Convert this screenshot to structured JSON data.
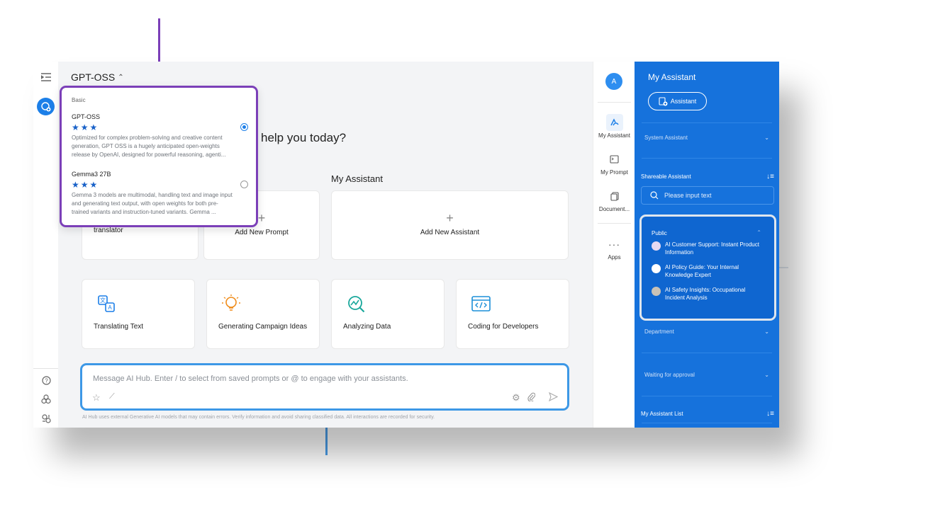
{
  "header": {
    "model_name": "GPT-OSS"
  },
  "main": {
    "greeting_partial": "help you today?",
    "my_assistant_label": "My Assistant",
    "prompt_cards": [
      {
        "label": "translator"
      },
      {
        "label": "Add New Prompt"
      },
      {
        "label": "Add New Assistant"
      }
    ],
    "features": [
      {
        "label": "Translating Text",
        "icon": "translate-icon"
      },
      {
        "label": "Generating Campaign Ideas",
        "icon": "lightbulb-icon"
      },
      {
        "label": "Analyzing Data",
        "icon": "analytics-icon"
      },
      {
        "label": "Coding for Developers",
        "icon": "code-icon"
      }
    ],
    "composer_placeholder": "Message AI Hub. Enter / to select from saved prompts or @ to engage with your assistants.",
    "disclaimer": "AI Hub uses external Generative AI models that may contain errors. Verify information and avoid sharing classified data. All interactions are recorded for security."
  },
  "dropdown": {
    "group": "Basic",
    "options": [
      {
        "name": "GPT-OSS",
        "stars": "★★★",
        "desc": "Optimized for complex problem-solving and creative content generation, GPT OSS is a hugely anticipated open-weights release by OpenAI, designed for powerful reasoning, agenti...",
        "selected": true
      },
      {
        "name": "Gemma3 27B",
        "stars": "★★★",
        "desc": "Gemma 3 models are multimodal, handling text and image input and generating text output, with open weights for both pre-trained variants and instruction-tuned variants. Gemma ...",
        "selected": false
      }
    ]
  },
  "secnav": {
    "avatar": "A",
    "items": [
      {
        "label": "My Assistant"
      },
      {
        "label": "My Prompt"
      },
      {
        "label": "Document..."
      },
      {
        "label": "Apps"
      }
    ]
  },
  "panel": {
    "title": "My Assistant",
    "button": "Assistant",
    "system": "System Assistant",
    "shareable": "Shareable Assistant",
    "search_placeholder": "Please input text",
    "public": "Public",
    "public_items": [
      "AI Customer Support: Instant Product Information",
      "AI Policy Guide: Your Internal Knowledge Expert",
      "AI Safety Insights: Occupational Incident Analysis"
    ],
    "department": "Department",
    "waiting": "Waiting for approval",
    "list": "My Assistant List"
  },
  "colors": {
    "accent": "#1672dc",
    "purple": "#7b3fb8",
    "composer_border": "#3d98e6"
  }
}
